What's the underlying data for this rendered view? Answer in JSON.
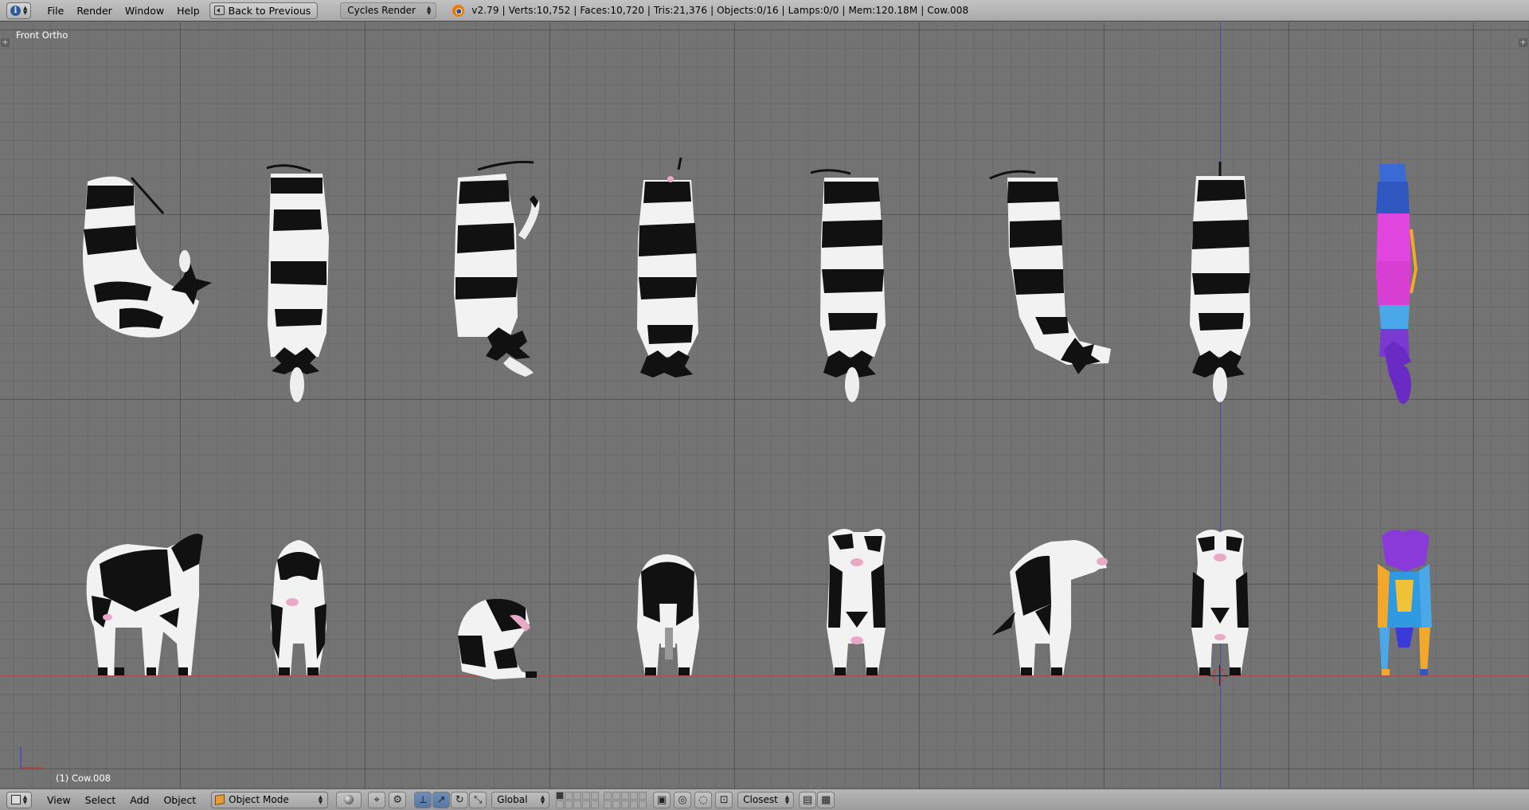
{
  "topbar": {
    "menus": [
      "File",
      "Render",
      "Window",
      "Help"
    ],
    "back_button": "Back to Previous",
    "render_engine": "Cycles Render",
    "stats": "v2.79 | Verts:10,752 | Faces:10,720 | Tris:21,376 | Objects:0/16 | Lamps:0/0 | Mem:120.18M | Cow.008"
  },
  "viewport": {
    "view_name": "Front Ortho",
    "active_object_label": "(1) Cow.008",
    "grid_color": "#737373",
    "x_axis_color": "#b05050",
    "z_axis_color": "#4b4bb0"
  },
  "bottombar": {
    "menus": [
      "View",
      "Select",
      "Add",
      "Object"
    ],
    "mode": "Object Mode",
    "orientation": "Global",
    "snap_target": "Closest"
  }
}
